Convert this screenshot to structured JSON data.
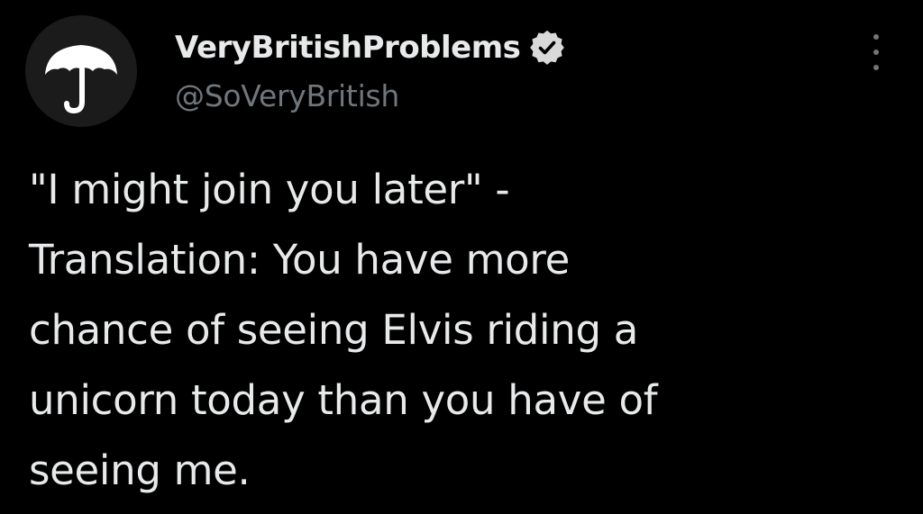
{
  "author": {
    "display_name": "VeryBritishProblems",
    "handle": "@SoVeryBritish",
    "verified": true,
    "avatar_icon": "umbrella-icon",
    "verified_icon": "verified-badge-icon"
  },
  "menu": {
    "icon": "more-options-icon"
  },
  "tweet": {
    "lines": [
      "\"I might join you later\" -",
      "Translation: You have more",
      "chance of seeing Elvis riding a",
      "unicorn today than you have of",
      "seeing me."
    ]
  },
  "colors": {
    "background": "#000000",
    "primary_text": "#e7e9ea",
    "secondary_text": "#71767b",
    "avatar_bg": "#1b1b1b"
  }
}
